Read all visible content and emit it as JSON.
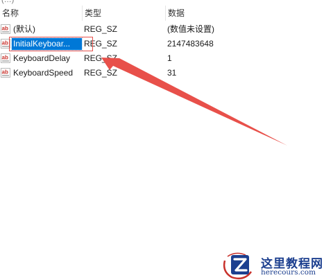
{
  "top_strip": {
    "text": "(…)"
  },
  "columns": {
    "name": "名称",
    "type": "类型",
    "data": "数据"
  },
  "rows": [
    {
      "name": "(默认)",
      "type": "REG_SZ",
      "data": "(数值未设置)",
      "selected": false,
      "icon": "string-value-ab-icon"
    },
    {
      "name": "InitialKeyboar...",
      "type": "REG_SZ",
      "data": "2147483648",
      "selected": true,
      "icon": "string-value-ab-icon"
    },
    {
      "name": "KeyboardDelay",
      "type": "REG_SZ",
      "data": "1",
      "selected": false,
      "icon": "string-value-ab-icon"
    },
    {
      "name": "KeyboardSpeed",
      "type": "REG_SZ",
      "data": "31",
      "selected": false,
      "icon": "string-value-ab-icon"
    }
  ],
  "colors": {
    "selection": "#0078d7",
    "annotation_red": "#e8504a",
    "watermark_blue": "#1c3f8f"
  },
  "watermark": {
    "title": "这里教程网",
    "url": "herecours.com"
  }
}
